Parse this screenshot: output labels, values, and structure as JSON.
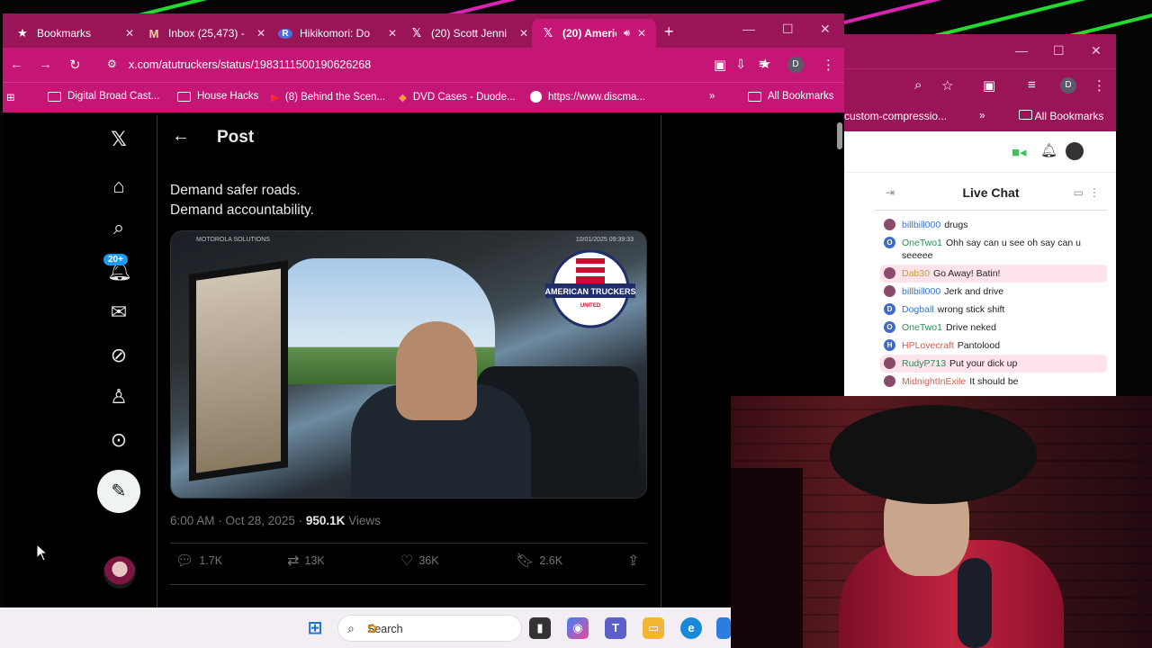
{
  "colors": {
    "chrome_accent": "#c51675",
    "tabstrip": "#9a1458",
    "x_blue": "#1d9bf0"
  },
  "tabs": [
    {
      "label": "Bookmarks",
      "icon": "star-icon"
    },
    {
      "label": "Inbox (25,473) -",
      "icon": "gmail-icon"
    },
    {
      "label": "Hikikomori: Do",
      "icon": "r-icon"
    },
    {
      "label": "(20) Scott Jenni",
      "icon": "x-icon"
    },
    {
      "label": "(20) Americ",
      "icon": "x-icon",
      "active": true
    }
  ],
  "address": {
    "url": "x.com/atutruckers/status/1983111500190626268"
  },
  "bookmarks": [
    {
      "label": "Digital Broad Cast..."
    },
    {
      "label": "House Hacks"
    },
    {
      "label": "(8) Behind the Scen..."
    },
    {
      "label": "DVD Cases - Duode..."
    },
    {
      "label": "https://www.discma..."
    }
  ],
  "all_bookmarks": "All Bookmarks",
  "x_nav": {
    "notif_badge": "20+"
  },
  "post": {
    "header": "Post",
    "text_line1": "Demand safer roads.",
    "text_line2": "Demand accountability.",
    "video_source": "MOTOROLA SOLUTIONS",
    "video_timestamp": "10/01/2025 09:39:33",
    "logo_text": "AMERICAN TRUCKERS",
    "logo_sub": "UNITED",
    "timestamp": "6:00 AM · Oct 28, 2025 · ",
    "views_value": "950.1K",
    "views_label": " Views",
    "replies": "1.7K",
    "reposts": "13K",
    "likes": "36K",
    "bookmarks": "2.6K"
  },
  "win2": {
    "bookmark_snippet": "custom-compressio...",
    "all_bookmarks": "All Bookmarks",
    "live_chat_title": "Live Chat",
    "messages": [
      {
        "user": "billbill000",
        "text": "drugs",
        "user_color": "#3d74c9",
        "avatar": ""
      },
      {
        "user": "OneTwo1",
        "text": "Ohh say can u see oh say can u seeeee",
        "user_color": "#2e8b57",
        "avatar": "O"
      },
      {
        "user": "Dab30",
        "text": "Go Away! Batin!",
        "user_color": "#c8a040",
        "avatar": "",
        "highlight": true
      },
      {
        "user": "billbill000",
        "text": "Jerk and drive",
        "user_color": "#3d74c9",
        "avatar": ""
      },
      {
        "user": "Dogball",
        "text": "wrong stick shift",
        "user_color": "#3d74c9",
        "avatar": "D"
      },
      {
        "user": "OneTwo1",
        "text": "Drive neked",
        "user_color": "#2e8b57",
        "avatar": "O"
      },
      {
        "user": "HPLovecraft",
        "text": "Pantolood",
        "user_color": "#e05a4a",
        "avatar": "H"
      },
      {
        "user": "RudyP713",
        "text": "Put your dick up",
        "user_color": "#2e8b57",
        "avatar": "",
        "highlight": true
      },
      {
        "user": "MidnightInExile",
        "text": "It should be",
        "user_color": "#e05a4a",
        "avatar": ""
      }
    ]
  },
  "taskbar": {
    "search_placeholder": "Search"
  }
}
